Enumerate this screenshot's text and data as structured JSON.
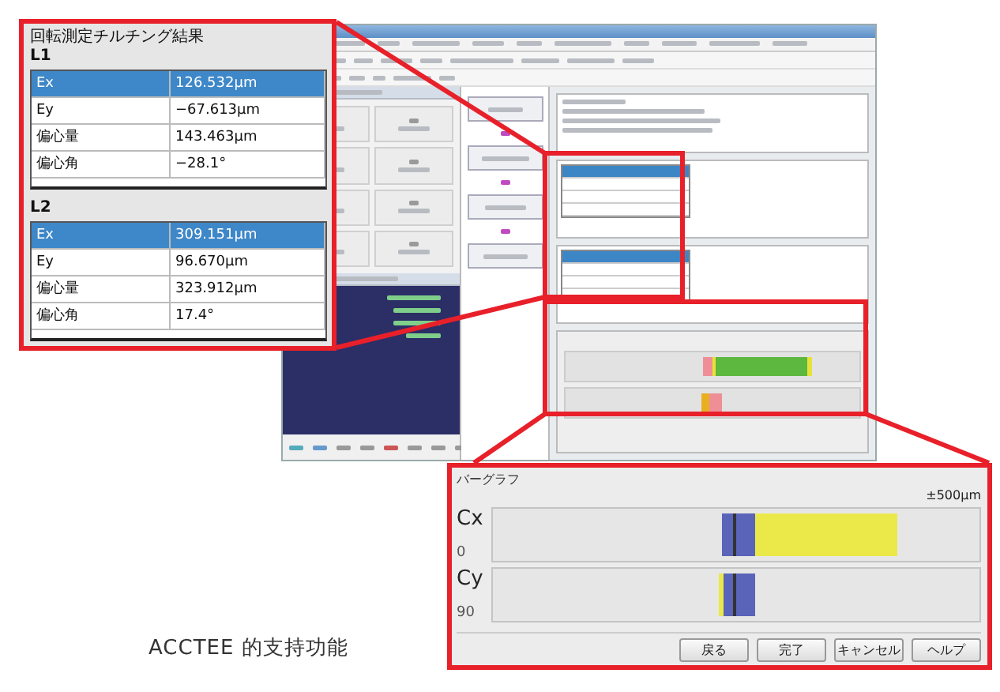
{
  "results_inset": {
    "title": "回転測定チルチング結果",
    "groups": [
      {
        "label": "L1",
        "rows": [
          {
            "name": "Ex",
            "value": "126.532μm",
            "selected": true
          },
          {
            "name": "Ey",
            "value": "−67.613μm",
            "selected": false
          },
          {
            "name": "偏心量",
            "value": "143.463μm",
            "selected": false
          },
          {
            "name": "偏心角",
            "value": "−28.1°",
            "selected": false
          }
        ]
      },
      {
        "label": "L2",
        "rows": [
          {
            "name": "Ex",
            "value": "309.151μm",
            "selected": true
          },
          {
            "name": "Ey",
            "value": "96.670μm",
            "selected": false
          },
          {
            "name": "偏心量",
            "value": "323.912μm",
            "selected": false
          },
          {
            "name": "偏心角",
            "value": "17.4°",
            "selected": false
          }
        ]
      }
    ]
  },
  "bargraph_inset": {
    "title": "バーグラフ",
    "scale": "±500μm",
    "rows": [
      {
        "axis": "Cx",
        "angle": "0"
      },
      {
        "axis": "Cy",
        "angle": "90"
      }
    ],
    "buttons": [
      "戻る",
      "完了",
      "キャンセル",
      "ヘルプ"
    ]
  },
  "caption": "ACCTEE 的支持功能"
}
